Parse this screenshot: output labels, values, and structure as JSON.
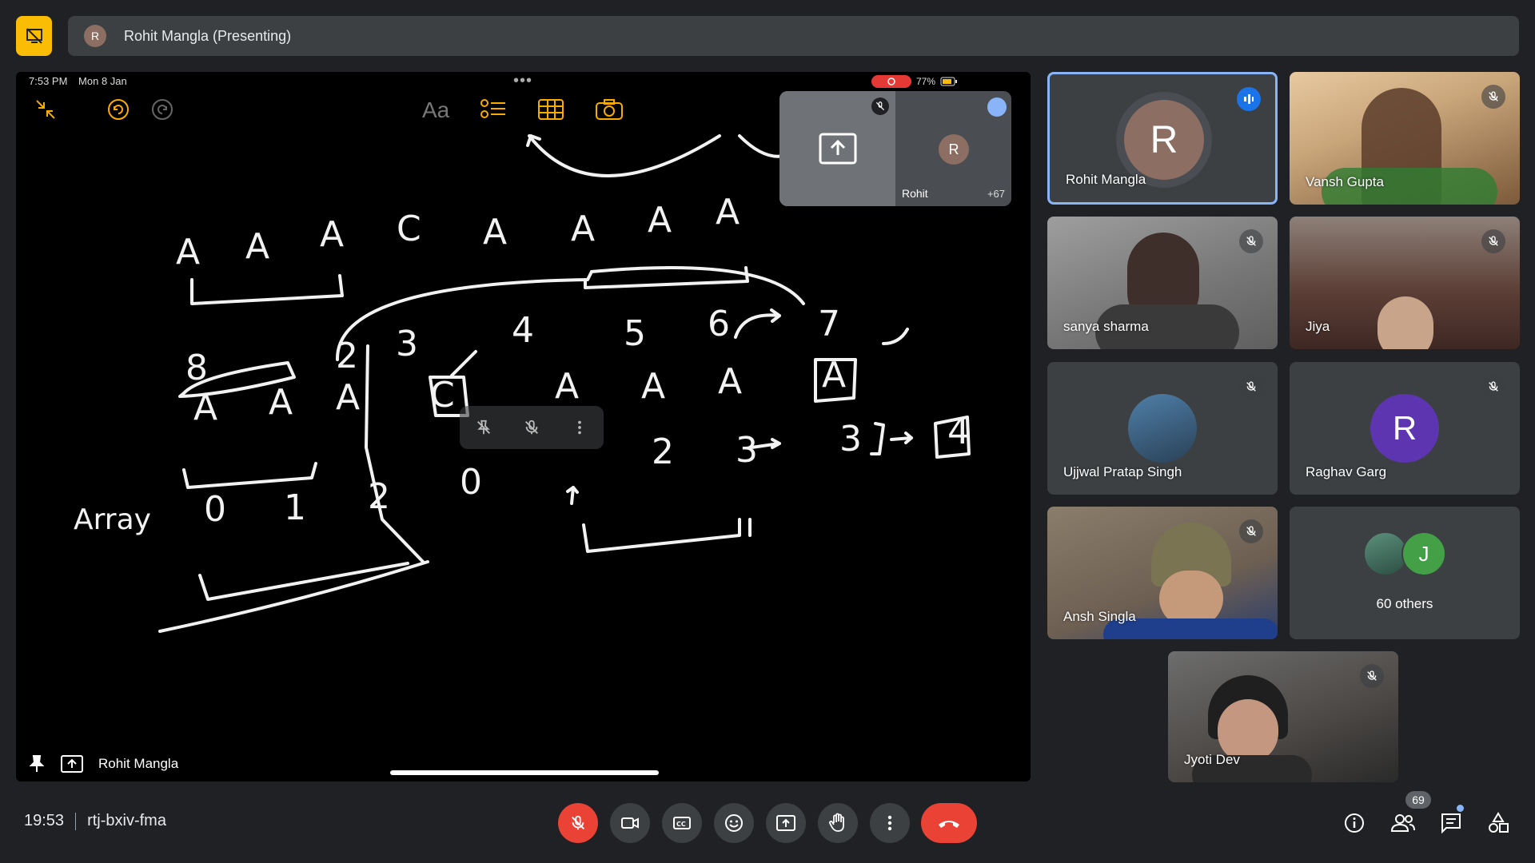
{
  "presenter_bar": {
    "avatar_letter": "R",
    "title": "Rohit Mangla (Presenting)"
  },
  "stage": {
    "status_time": "7:53 PM",
    "status_date": "Mon 8 Jan",
    "battery": "77%",
    "text_tool": "Aa",
    "mini_preview": {
      "avatar_letter": "R",
      "name": "Rohit",
      "more_count": "+67"
    },
    "presenter_name": "Rohit Mangla"
  },
  "tiles": [
    {
      "name": "Rohit Mangla",
      "avatar_letter": "R",
      "speaking": true
    },
    {
      "name": "Vansh Gupta"
    },
    {
      "name": "sanya sharma"
    },
    {
      "name": "Jiya"
    },
    {
      "name": "Ujjwal Pratap Singh"
    },
    {
      "name": "Raghav Garg",
      "avatar_letter": "R"
    },
    {
      "name": "Ansh Singla"
    },
    {
      "name": "60 others",
      "avatar_letter": "J"
    },
    {
      "name": "Jyoti Dev"
    }
  ],
  "bottom_bar": {
    "time": "19:53",
    "meeting_code": "rtj-bxiv-fma",
    "participant_count": "69"
  },
  "colors": {
    "accent_yellow": "#fbbc04",
    "end_call_red": "#ea4335",
    "speaking_blue": "#8ab4f8",
    "raghav_purple": "#5e35b1",
    "j_green": "#43a047"
  }
}
